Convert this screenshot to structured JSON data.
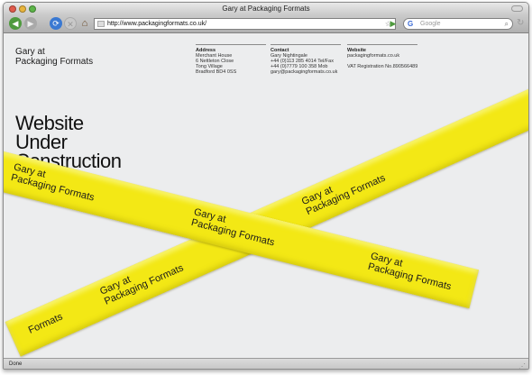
{
  "window": {
    "title": "Gary at Packaging Formats"
  },
  "toolbar": {
    "back": "◀",
    "forward": "▶",
    "reload": "⟳",
    "stop": "✕",
    "home": "⌂",
    "url": "http://www.packagingformats.co.uk/",
    "search_placeholder": "Google",
    "search_engine_glyph": "G"
  },
  "page": {
    "brand": {
      "line1": "Gary at",
      "line2": "Packaging Formats"
    },
    "address": {
      "heading": "Address",
      "lines": [
        "Merchant House",
        "6 Nettleton Close",
        "Tong Village",
        "Bradford BD4 0SS"
      ]
    },
    "contact": {
      "heading": "Contact",
      "lines": [
        "Gary Nightingale",
        "+44 (0)113 285 4014 Tel/Fax",
        "+44 (0)7779 100 358 Mob",
        "gary@packagingformats.co.uk"
      ]
    },
    "website": {
      "heading": "Website",
      "lines": [
        "packagingformats.co.uk"
      ],
      "vat": "VAT Registration No.890566489"
    },
    "headline": {
      "line1": "Website",
      "line2": "Under",
      "line3": "Construction"
    },
    "tape": {
      "line1": "Gary at",
      "line2": "Packaging Formats",
      "fragment": "Formats"
    }
  },
  "statusbar": {
    "text": "Done"
  },
  "colors": {
    "tape": "#f3e815",
    "page_bg": "#ecedee",
    "text": "#111111"
  },
  "icons": [
    "back-arrow-icon",
    "forward-arrow-icon",
    "reload-icon",
    "stop-icon",
    "home-icon",
    "bookmark-star-icon",
    "search-icon",
    "go-arrow-icon"
  ]
}
